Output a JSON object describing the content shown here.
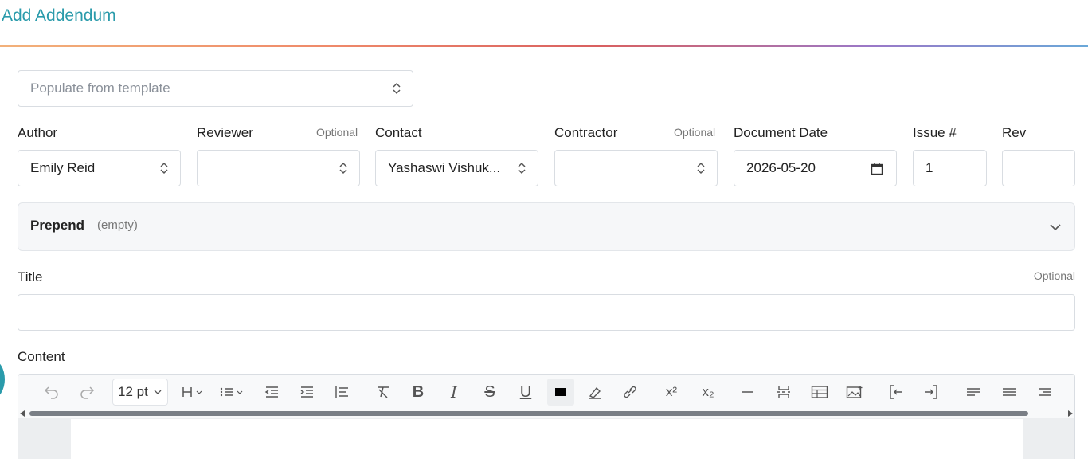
{
  "header": {
    "title": "Add Addendum"
  },
  "template": {
    "placeholder": "Populate from template"
  },
  "fields": {
    "author": {
      "label": "Author",
      "value": "Emily Reid"
    },
    "reviewer": {
      "label": "Reviewer",
      "optional": "Optional",
      "value": ""
    },
    "contact": {
      "label": "Contact",
      "value": "Yashaswi Vishuk..."
    },
    "contractor": {
      "label": "Contractor",
      "optional": "Optional",
      "value": ""
    },
    "document_date": {
      "label": "Document Date",
      "value": "2026-05-20"
    },
    "issue": {
      "label": "Issue #",
      "value": "1"
    },
    "rev": {
      "label": "Rev",
      "value": ""
    }
  },
  "prepend": {
    "label": "Prepend",
    "status": "(empty)"
  },
  "title_field": {
    "label": "Title",
    "optional": "Optional",
    "value": ""
  },
  "content": {
    "label": "Content",
    "font_size": "12 pt",
    "toolbar_icons": [
      "undo-icon",
      "redo-icon",
      "heading-icon",
      "list-icon",
      "outdent-icon",
      "indent-icon",
      "blockquote-icon",
      "clear-format-icon",
      "bold-icon",
      "italic-icon",
      "strikethrough-icon",
      "underline-icon",
      "text-color-icon",
      "highlight-icon",
      "link-icon",
      "superscript-icon",
      "subscript-icon",
      "horizontal-rule-icon",
      "page-break-icon",
      "table-icon",
      "image-icon",
      "import-icon",
      "export-icon",
      "align-left-icon",
      "align-center-icon",
      "align-right-icon"
    ],
    "text_color": "#000000",
    "superscript_label": "x²",
    "subscript_label": "x₂"
  },
  "colors": {
    "accent": "#2a9bab"
  }
}
